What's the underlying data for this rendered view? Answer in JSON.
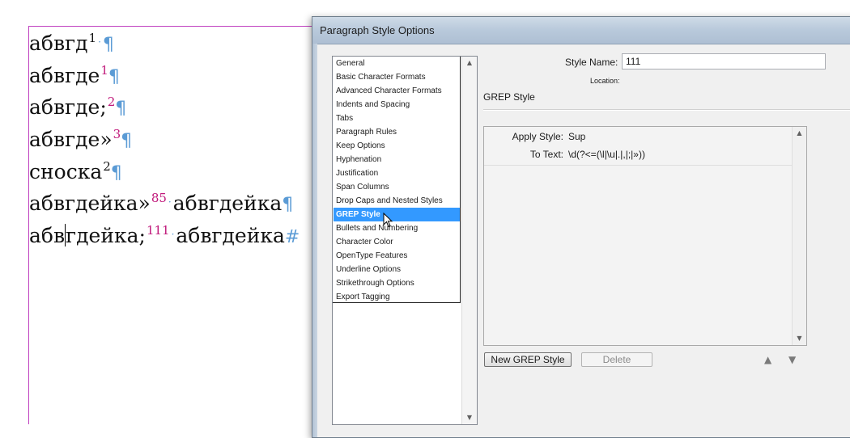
{
  "document": {
    "lines": [
      {
        "text": "абвгд",
        "sup": "1",
        "sup_color": "black",
        "end": "¶",
        "dot_before_end": true
      },
      {
        "text": "абвгде",
        "sup": "1",
        "sup_color": "red",
        "end": "¶"
      },
      {
        "text": "абвгде;",
        "sup": "2",
        "sup_color": "red",
        "end": "¶"
      },
      {
        "text": "абвгде»",
        "sup": "3",
        "sup_color": "red",
        "end": "¶"
      },
      {
        "text": "сноска",
        "sup": "2",
        "sup_color": "black",
        "end": "¶"
      },
      {
        "text": "абвгдейка»",
        "sup": "85",
        "sup_color": "red",
        "after": "абвгдейка",
        "end": "¶"
      },
      {
        "text_a": "абв",
        "text_b": "гдейка;",
        "sup": "111",
        "sup_color": "red",
        "after": "абвгдейка",
        "end": "#"
      }
    ]
  },
  "dialog": {
    "title": "Paragraph Style Options",
    "categories": [
      "General",
      "Basic Character Formats",
      "Advanced Character Formats",
      "Indents and Spacing",
      "Tabs",
      "Paragraph Rules",
      "Keep Options",
      "Hyphenation",
      "Justification",
      "Span Columns",
      "Drop Caps and Nested Styles",
      "GREP Style",
      "Bullets and Numbering",
      "Character Color",
      "OpenType Features",
      "Underline Options",
      "Strikethrough Options",
      "Export Tagging"
    ],
    "selected_category": "GREP Style",
    "style_name_label": "Style Name:",
    "style_name_value": "111",
    "location_label": "Location:",
    "section_title": "GREP Style",
    "grep": {
      "apply_style_label": "Apply Style:",
      "apply_style_value": "Sup",
      "to_text_label": "To Text:",
      "to_text_value": "\\d(?<=(\\l|\\u|.|,|;|»))"
    },
    "new_grep_button": "New GREP Style",
    "delete_button": "Delete"
  }
}
